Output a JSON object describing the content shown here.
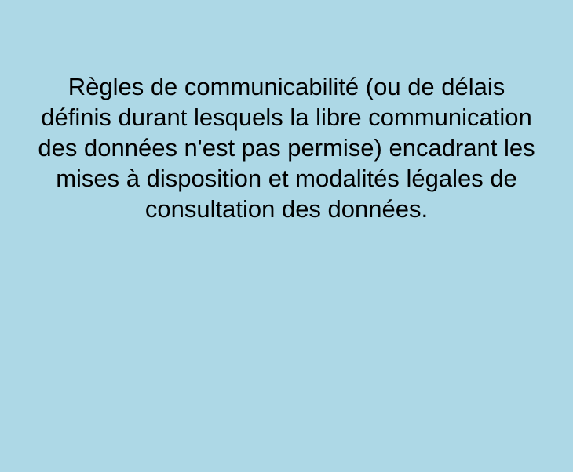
{
  "card": {
    "background_color": "#ADD8E6",
    "text_color": "#000000",
    "text": "Règles de communicabilité (ou de délais définis durant lesquels la libre communication des données n'est pas permise) encadrant les mises à disposition et modalités légales de consultation des données."
  }
}
